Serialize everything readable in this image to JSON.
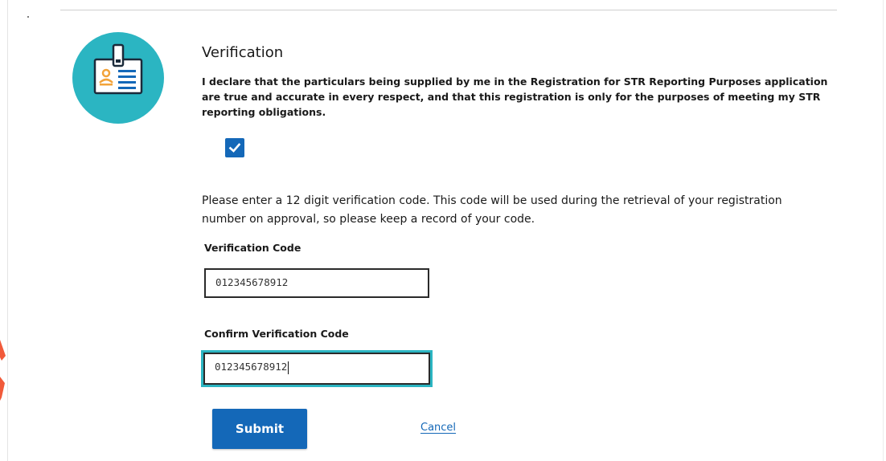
{
  "verification": {
    "title": "Verification",
    "declaration": "I declare that the particulars being supplied by me in the Registration for STR Reporting Purposes application are true and accurate in every respect, and that this registration is only for the purposes of meeting my STR reporting obligations.",
    "declaration_checked": true,
    "instructions": "Please enter a 12 digit verification code. This code will be used during the retrieval of your registration number on approval, so please keep a record of your code.",
    "verification_code_label": "Verification Code",
    "verification_code_value": "012345678912",
    "confirm_code_label": "Confirm Verification Code",
    "confirm_code_value": "012345678912",
    "submit_label": "Submit",
    "cancel_label": "Cancel"
  },
  "icon": {
    "name": "id-badge-icon",
    "circle_color": "#2bb5c2"
  },
  "colors": {
    "primary": "#1468b8",
    "focus_ring": "#2bb5c2",
    "accent_edge": "#f15a3a"
  }
}
